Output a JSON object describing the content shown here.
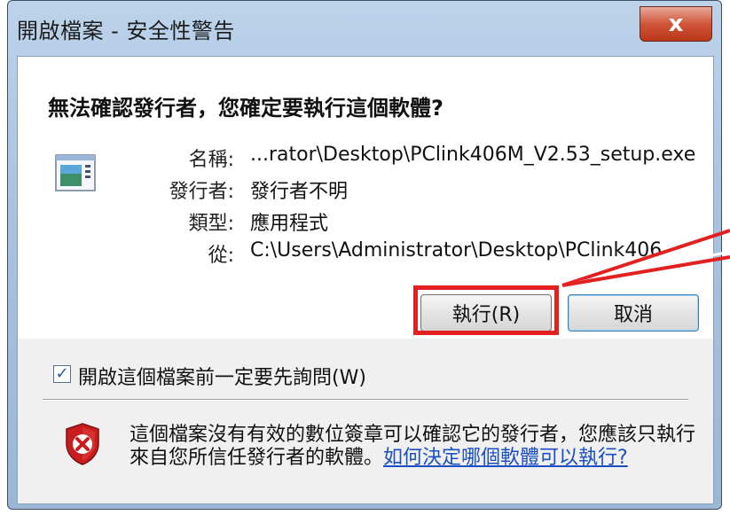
{
  "window": {
    "title": "開啟檔案 - 安全性警告",
    "close_label": "x"
  },
  "dialog": {
    "question": "無法確認發行者，您確定要執行這個軟體?",
    "fields": [
      {
        "label": "名稱:",
        "value": "...rator\\Desktop\\PClink406M_V2.53_setup.exe"
      },
      {
        "label": "發行者:",
        "value": "發行者不明"
      },
      {
        "label": "類型:",
        "value": "應用程式"
      },
      {
        "label": "從:",
        "value": "C:\\Users\\Administrator\\Desktop\\PClink406"
      }
    ],
    "run_button": "執行(R)",
    "cancel_button": "取消",
    "checkbox_label": "開啟這個檔案前一定要先詢問(W)",
    "checkbox_checked": true,
    "checkbox_mark": "✓",
    "warning_text": "這個檔案沒有有效的數位簽章可以確認它的發行者，您應該只執行來自您所信任發行者的軟體。",
    "warning_link": "如何決定哪個軟體可以執行?"
  },
  "colors": {
    "highlight": "#e32020",
    "link": "#1a4fc3"
  }
}
